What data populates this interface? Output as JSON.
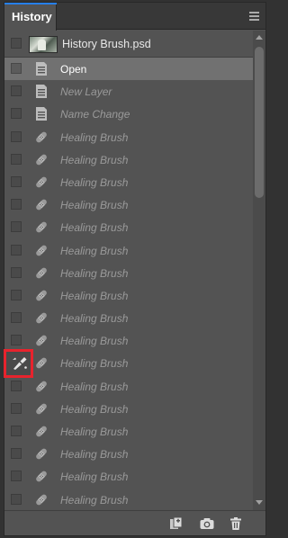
{
  "panel": {
    "tab_label": "History",
    "menu_icon": "panel-menu-icon"
  },
  "snapshot": {
    "label": "History Brush.psd",
    "icon": "snapshot-thumbnail"
  },
  "items": [
    {
      "label": "Open",
      "icon": "document-icon",
      "active": true
    },
    {
      "label": "New Layer",
      "icon": "document-icon",
      "active": false
    },
    {
      "label": "Name Change",
      "icon": "document-icon",
      "active": false
    },
    {
      "label": "Healing Brush",
      "icon": "bandage-icon",
      "active": false
    },
    {
      "label": "Healing Brush",
      "icon": "bandage-icon",
      "active": false
    },
    {
      "label": "Healing Brush",
      "icon": "bandage-icon",
      "active": false
    },
    {
      "label": "Healing Brush",
      "icon": "bandage-icon",
      "active": false
    },
    {
      "label": "Healing Brush",
      "icon": "bandage-icon",
      "active": false
    },
    {
      "label": "Healing Brush",
      "icon": "bandage-icon",
      "active": false
    },
    {
      "label": "Healing Brush",
      "icon": "bandage-icon",
      "active": false
    },
    {
      "label": "Healing Brush",
      "icon": "bandage-icon",
      "active": false
    },
    {
      "label": "Healing Brush",
      "icon": "bandage-icon",
      "active": false
    },
    {
      "label": "Healing Brush",
      "icon": "bandage-icon",
      "active": false
    },
    {
      "label": "Healing Brush",
      "icon": "bandage-icon",
      "active": false
    },
    {
      "label": "Healing Brush",
      "icon": "bandage-icon",
      "active": false
    },
    {
      "label": "Healing Brush",
      "icon": "bandage-icon",
      "active": false
    },
    {
      "label": "Healing Brush",
      "icon": "bandage-icon",
      "active": false
    },
    {
      "label": "Healing Brush",
      "icon": "bandage-icon",
      "active": false
    },
    {
      "label": "Healing Brush",
      "icon": "bandage-icon",
      "active": false
    },
    {
      "label": "Healing Brush",
      "icon": "bandage-icon",
      "active": false
    }
  ],
  "history_brush_source": {
    "icon": "history-brush-source-icon",
    "highlight_color": "#e8232d"
  },
  "footer": {
    "buttons": [
      "new-document-from-state-icon",
      "camera-snapshot-icon",
      "trash-icon"
    ]
  },
  "colors": {
    "accent": "#2680eb",
    "active_row": "#717171",
    "panel_bg": "#535353"
  }
}
